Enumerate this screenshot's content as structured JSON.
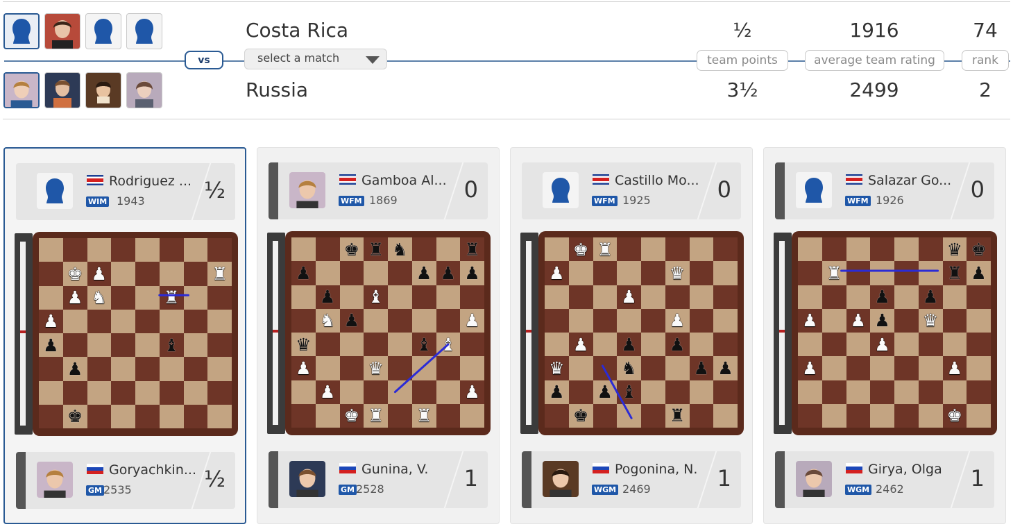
{
  "header": {
    "team1": {
      "name": "Costa Rica",
      "points": "½",
      "avg_rating": "1916",
      "rank": "74"
    },
    "team2": {
      "name": "Russia",
      "points": "3½",
      "avg_rating": "2499",
      "rank": "2"
    },
    "vs_label": "vs",
    "select_placeholder": "select a match",
    "labels": {
      "team_points": "team points",
      "avg_rating": "average team rating",
      "rank": "rank"
    }
  },
  "boards": [
    {
      "top": {
        "name": "Rodriguez ...",
        "title": "WIM",
        "rating": "1943",
        "score": "½",
        "avatar": "silhouette-icon",
        "bar": "light"
      },
      "bottom": {
        "name": "Goryachkin...",
        "title": "GM",
        "rating": "2535",
        "score": "½",
        "avatar": "player-photo"
      },
      "position": [
        "........",
        ".KP....R",
        ".PN..R..",
        "P.......",
        "p....b..",
        ".p......",
        "........",
        ".k......"
      ]
    },
    {
      "top": {
        "name": "Gamboa Al...",
        "title": "WFM",
        "rating": "1869",
        "score": "0",
        "avatar": "player-photo",
        "bar": "dark"
      },
      "bottom": {
        "name": "Gunina, V.",
        "title": "GM",
        "rating": "2528",
        "score": "1",
        "avatar": "player-photo"
      },
      "position": [
        "..krn..r",
        "p....ppp",
        ".p.B....",
        ".Np....P",
        "q....bB.",
        "P..Q....",
        ".P.....P",
        "..KR.R.."
      ]
    },
    {
      "top": {
        "name": "Castillo Mo...",
        "title": "WFM",
        "rating": "1925",
        "score": "0",
        "avatar": "silhouette-icon",
        "bar": "light"
      },
      "bottom": {
        "name": "Pogonina, N.",
        "title": "WGM",
        "rating": "2469",
        "score": "1",
        "avatar": "player-photo"
      },
      "position": [
        ".KR.....",
        "P....Q..",
        "...P....",
        ".....P..",
        ".P.p.p..",
        "Q..n..pp",
        "p.pb....",
        ".k...r.."
      ]
    },
    {
      "top": {
        "name": "Salazar Go...",
        "title": "WFM",
        "rating": "1926",
        "score": "0",
        "avatar": "silhouette-icon",
        "bar": "dark"
      },
      "bottom": {
        "name": "Girya, Olga",
        "title": "WGM",
        "rating": "2462",
        "score": "1",
        "avatar": "player-photo"
      },
      "position": [
        "......qk",
        ".R....rp",
        "...p.p..",
        "P.Pp.Q..",
        "...P....",
        "P.....P.",
        "........",
        "......K."
      ]
    }
  ],
  "colors": {
    "accent": "#2a5a93",
    "board_light": "#c3a482",
    "board_dark": "#6e3527",
    "title_badge": "#1f57a8",
    "arrow": "#2b2bd6"
  }
}
